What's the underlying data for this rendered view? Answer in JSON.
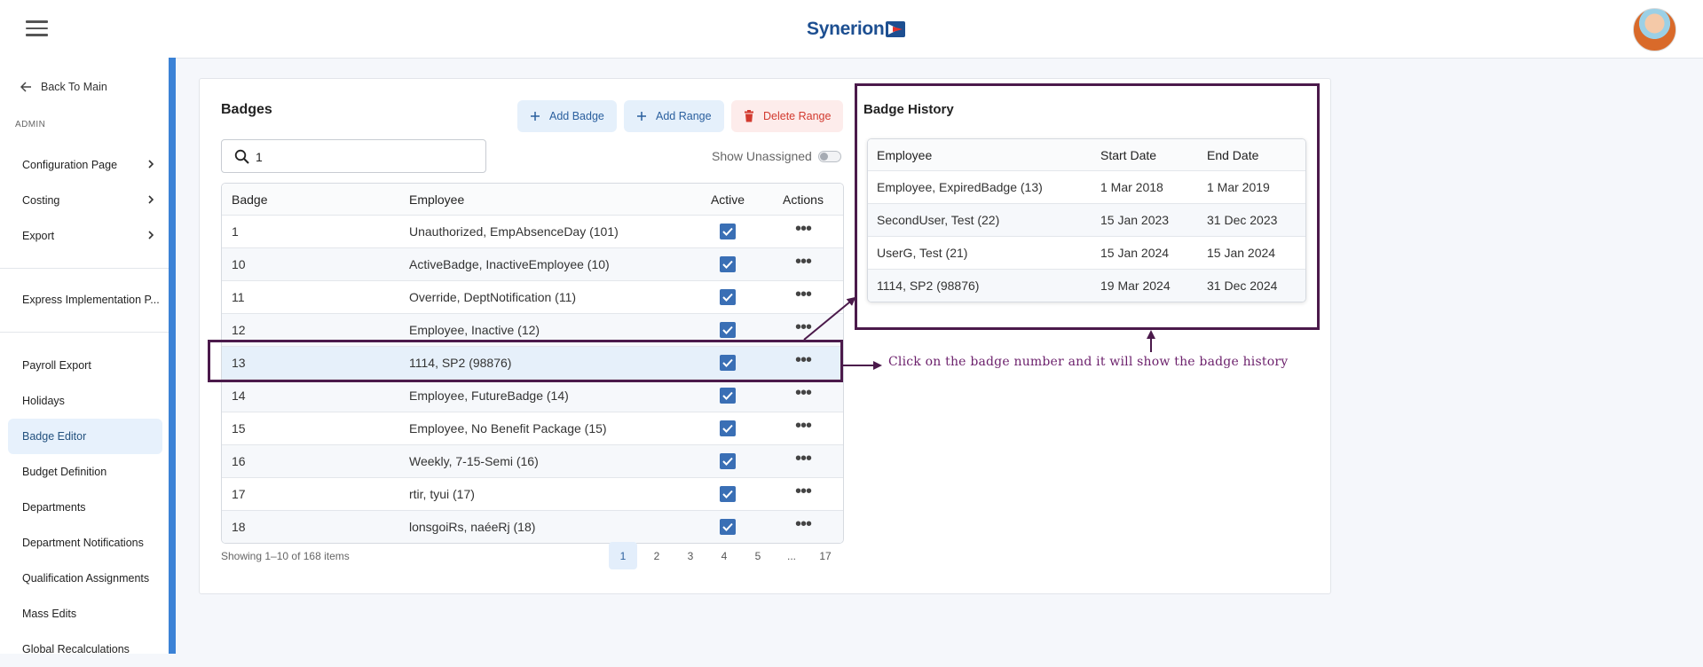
{
  "header": {
    "logo_text": "Synerion",
    "brand_color": "#1d4f91",
    "menu_icon": "hamburger-icon",
    "avatar_icon": "user-avatar"
  },
  "sidebar": {
    "back_label": "Back To Main",
    "admin_label": "ADMIN",
    "accent_color": "#3b82d6",
    "group1": [
      {
        "label": "Configuration Page"
      },
      {
        "label": "Costing"
      },
      {
        "label": "Export"
      }
    ],
    "group2": [
      {
        "label": "Express Implementation P..."
      }
    ],
    "group3": [
      {
        "label": "Payroll Export"
      },
      {
        "label": "Holidays"
      },
      {
        "label": "Badge Editor",
        "active": true
      },
      {
        "label": "Budget Definition"
      },
      {
        "label": "Departments"
      },
      {
        "label": "Department Notifications"
      },
      {
        "label": "Qualification Assignments"
      },
      {
        "label": "Mass Edits"
      },
      {
        "label": "Global Recalculations"
      }
    ]
  },
  "badges": {
    "title": "Badges",
    "add_badge_label": "Add Badge",
    "add_range_label": "Add Range",
    "delete_range_label": "Delete Range",
    "search_value": "1",
    "show_unassigned_label": "Show Unassigned",
    "show_unassigned_on": false,
    "columns": [
      "Badge",
      "Employee",
      "Active",
      "Actions"
    ],
    "rows": [
      {
        "badge": "1",
        "employee": "Unauthorized, EmpAbsenceDay (101)",
        "active": true
      },
      {
        "badge": "10",
        "employee": "ActiveBadge, InactiveEmployee (10)",
        "active": true
      },
      {
        "badge": "11",
        "employee": "Override, DeptNotification (11)",
        "active": true
      },
      {
        "badge": "12",
        "employee": "Employee, Inactive (12)",
        "active": true
      },
      {
        "badge": "13",
        "employee": "1114, SP2 (98876)",
        "active": true,
        "selected": true
      },
      {
        "badge": "14",
        "employee": "Employee, FutureBadge (14)",
        "active": true
      },
      {
        "badge": "15",
        "employee": "Employee, No Benefit Package (15)",
        "active": true
      },
      {
        "badge": "16",
        "employee": "Weekly, 7-15-Semi (16)",
        "active": true
      },
      {
        "badge": "17",
        "employee": "rtir, tyui (17)",
        "active": true
      },
      {
        "badge": "18",
        "employee": "lonsgoiRs, naéeRj (18)",
        "active": true
      }
    ],
    "showing_text": "Showing 1–10 of 168 items",
    "pages": [
      "1",
      "2",
      "3",
      "4",
      "5",
      "...",
      "17"
    ],
    "current_page": "1"
  },
  "history": {
    "title": "Badge History",
    "columns": [
      "Employee",
      "Start Date",
      "End Date"
    ],
    "rows": [
      {
        "employee": "Employee, ExpiredBadge (13)",
        "start": "1 Mar 2018",
        "end": "1 Mar 2019"
      },
      {
        "employee": "SecondUser, Test (22)",
        "start": "15 Jan 2023",
        "end": "31 Dec 2023"
      },
      {
        "employee": "UserG, Test (21)",
        "start": "15 Jan 2024",
        "end": "15 Jan 2024"
      },
      {
        "employee": "1114, SP2 (98876)",
        "start": "19 Mar 2024",
        "end": "31 Dec 2024"
      }
    ]
  },
  "annotation": {
    "text": "Click on the badge number and it will show the badge history",
    "color": "#4b1a4b"
  }
}
